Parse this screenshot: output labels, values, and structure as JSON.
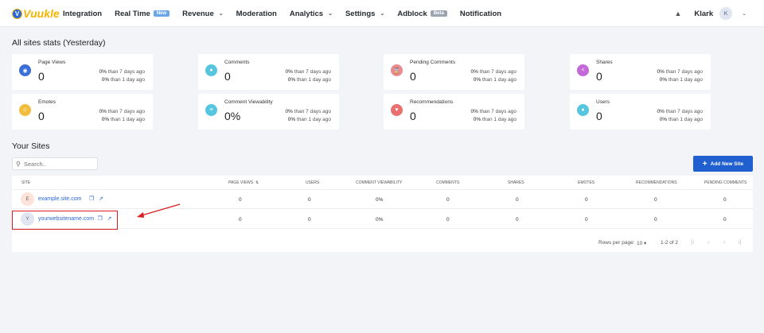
{
  "brand": {
    "badge": "V",
    "name": "Vuukle"
  },
  "nav": {
    "items": [
      {
        "label": "Integration",
        "chevron": false
      },
      {
        "label": "Real Time",
        "chevron": false,
        "badge": "New"
      },
      {
        "label": "Revenue",
        "chevron": true
      },
      {
        "label": "Moderation",
        "chevron": false
      },
      {
        "label": "Analytics",
        "chevron": true
      },
      {
        "label": "Settings",
        "chevron": true
      },
      {
        "label": "Adblock",
        "chevron": false,
        "badge": "Beta"
      },
      {
        "label": "Notification",
        "chevron": false
      }
    ],
    "user_name": "Klark",
    "avatar_initial": "K"
  },
  "stats_title": "All sites stats (Yesterday)",
  "stats": [
    {
      "label": "Page Views",
      "value": "0",
      "cmp7_pct": "0%",
      "cmp7_text": " than 7 days ago",
      "cmp1_pct": "0%",
      "cmp1_text": " than 1 day ago",
      "icon": "eye-icon",
      "color": "#3a6fd8"
    },
    {
      "label": "Comments",
      "value": "0",
      "cmp7_pct": "0%",
      "cmp7_text": " than 7 days ago",
      "cmp1_pct": "0%",
      "cmp1_text": " than 1 day ago",
      "icon": "comments-icon",
      "color": "#56c6e0"
    },
    {
      "label": "Pending Comments",
      "value": "0",
      "cmp7_pct": "0%",
      "cmp7_text": " than 7 days ago",
      "cmp1_pct": "0%",
      "cmp1_text": " than 1 day ago",
      "icon": "hourglass-icon",
      "color": "#e88a8f"
    },
    {
      "label": "Shares",
      "value": "0",
      "cmp7_pct": "0%",
      "cmp7_text": " than 7 days ago",
      "cmp1_pct": "0%",
      "cmp1_text": " than 1 day ago",
      "icon": "share-icon",
      "color": "#c36ad8"
    },
    {
      "label": "Emotes",
      "value": "0",
      "cmp7_pct": "0%",
      "cmp7_text": " than 7 days ago",
      "cmp1_pct": "0%",
      "cmp1_text": " than 1 day ago",
      "icon": "smile-icon",
      "color": "#f2bd3d"
    },
    {
      "label": "Comment Viewability",
      "value": "0%",
      "cmp7_pct": "0%",
      "cmp7_text": " than 7 days ago",
      "cmp1_pct": "0%",
      "cmp1_text": " than 1 day ago",
      "icon": "viewability-icon",
      "color": "#56c6e0"
    },
    {
      "label": "Recommendations",
      "value": "0",
      "cmp7_pct": "0%",
      "cmp7_text": " than 7 days ago",
      "cmp1_pct": "0%",
      "cmp1_text": " than 1 day ago",
      "icon": "heart-icon",
      "color": "#e8706f"
    },
    {
      "label": "Users",
      "value": "0",
      "cmp7_pct": "0%",
      "cmp7_text": " than 7 days ago",
      "cmp1_pct": "0%",
      "cmp1_text": " than 1 day ago",
      "icon": "user-icon",
      "color": "#56c6e0"
    }
  ],
  "sites_title": "Your Sites",
  "search": {
    "placeholder": "Search.."
  },
  "add_button": "Add New Site",
  "table": {
    "columns": [
      "Site",
      "Page Views",
      "Users",
      "Comment Viewability",
      "Comments",
      "Shares",
      "Emotes",
      "Recommendations",
      "Pending Comments"
    ],
    "rows": [
      {
        "initial": "E",
        "site": "example.site.com",
        "avatar_color": "#fde3d9",
        "cells": [
          "0",
          "0",
          "0%",
          "0",
          "0",
          "0",
          "0",
          "0"
        ]
      },
      {
        "initial": "Y",
        "site": "yourwebsitename.com",
        "avatar_color": "#dfe6f1",
        "cells": [
          "0",
          "0",
          "0%",
          "0",
          "0",
          "0",
          "0",
          "0"
        ]
      }
    ],
    "rows_per_page_label": "Rows per page:",
    "rows_per_page": "10",
    "range": "1-2 of 2"
  }
}
